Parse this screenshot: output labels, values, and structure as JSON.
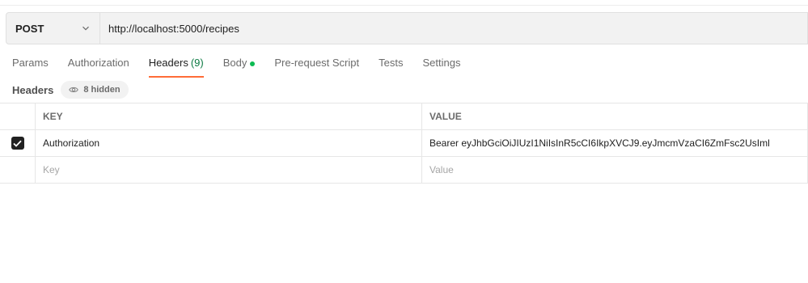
{
  "request": {
    "method": "POST",
    "url": "http://localhost:5000/recipes"
  },
  "tabs": [
    {
      "label": "Params"
    },
    {
      "label": "Authorization"
    },
    {
      "label": "Headers",
      "count": "(9)",
      "active": true
    },
    {
      "label": "Body",
      "has_dot": true
    },
    {
      "label": "Pre-request Script"
    },
    {
      "label": "Tests"
    },
    {
      "label": "Settings"
    }
  ],
  "headers_section": {
    "title": "Headers",
    "hidden_label": "8 hidden"
  },
  "table": {
    "col_key": "KEY",
    "col_value": "VALUE",
    "rows": [
      {
        "checked": true,
        "key": "Authorization",
        "value": "Bearer eyJhbGciOiJIUzI1NiIsInR5cCI6IkpXVCJ9.eyJmcmVzaCI6ZmFsc2UsIml"
      }
    ],
    "key_placeholder": "Key",
    "value_placeholder": "Value"
  },
  "colors": {
    "accent": "#ff6c37",
    "count_green": "#0c7a43",
    "body_dot": "#0cbb52"
  },
  "icons": {
    "method_dropdown": "chevron-down-icon",
    "hidden_toggle": "eye-icon",
    "row_checkbox": "checkmark-icon"
  }
}
